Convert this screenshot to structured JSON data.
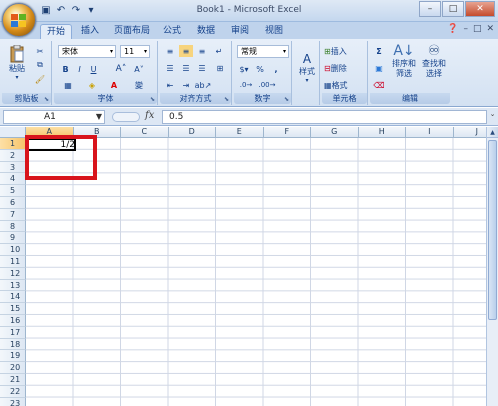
{
  "window": {
    "title": "Book1 - Microsoft Excel"
  },
  "qat": {
    "icons": [
      "save-icon",
      "undo-icon",
      "redo-icon",
      "customize-icon"
    ]
  },
  "tabs": [
    "开始",
    "插入",
    "页面布局",
    "公式",
    "数据",
    "审阅",
    "视图"
  ],
  "active_tab": "开始",
  "ribbon": {
    "clipboard": {
      "paste_label": "粘贴",
      "group_label": "剪贴板"
    },
    "font": {
      "font_name": "宋体",
      "font_size": "11",
      "bold": "B",
      "italic": "I",
      "underline": "U",
      "group_label": "字体"
    },
    "alignment": {
      "group_label": "对齐方式"
    },
    "number": {
      "format": "常规",
      "percent": "%",
      "comma": ",",
      "group_label": "数字"
    },
    "styles": {
      "label": "样式"
    },
    "cells": {
      "insert": "插入",
      "delete": "删除",
      "format": "格式",
      "group_label": "单元格"
    },
    "editing": {
      "sort_filter": "排序和\n筛选",
      "find_select": "查找和\n选择",
      "sigma": "Σ",
      "group_label": "编辑"
    }
  },
  "formula_bar": {
    "name_box": "A1",
    "fx": "fx",
    "value": "0.5"
  },
  "columns": [
    "A",
    "B",
    "C",
    "D",
    "E",
    "F",
    "G",
    "H",
    "I",
    "J"
  ],
  "rows": [
    "1",
    "2",
    "3",
    "4",
    "5",
    "6",
    "7",
    "8",
    "9",
    "10",
    "11",
    "12",
    "13",
    "14",
    "15",
    "16",
    "17",
    "18",
    "19",
    "20",
    "21",
    "22",
    "23"
  ],
  "cell_A1": "1/2",
  "colors": {
    "highlight_box": "#d8141c",
    "accent": "#15428b"
  }
}
